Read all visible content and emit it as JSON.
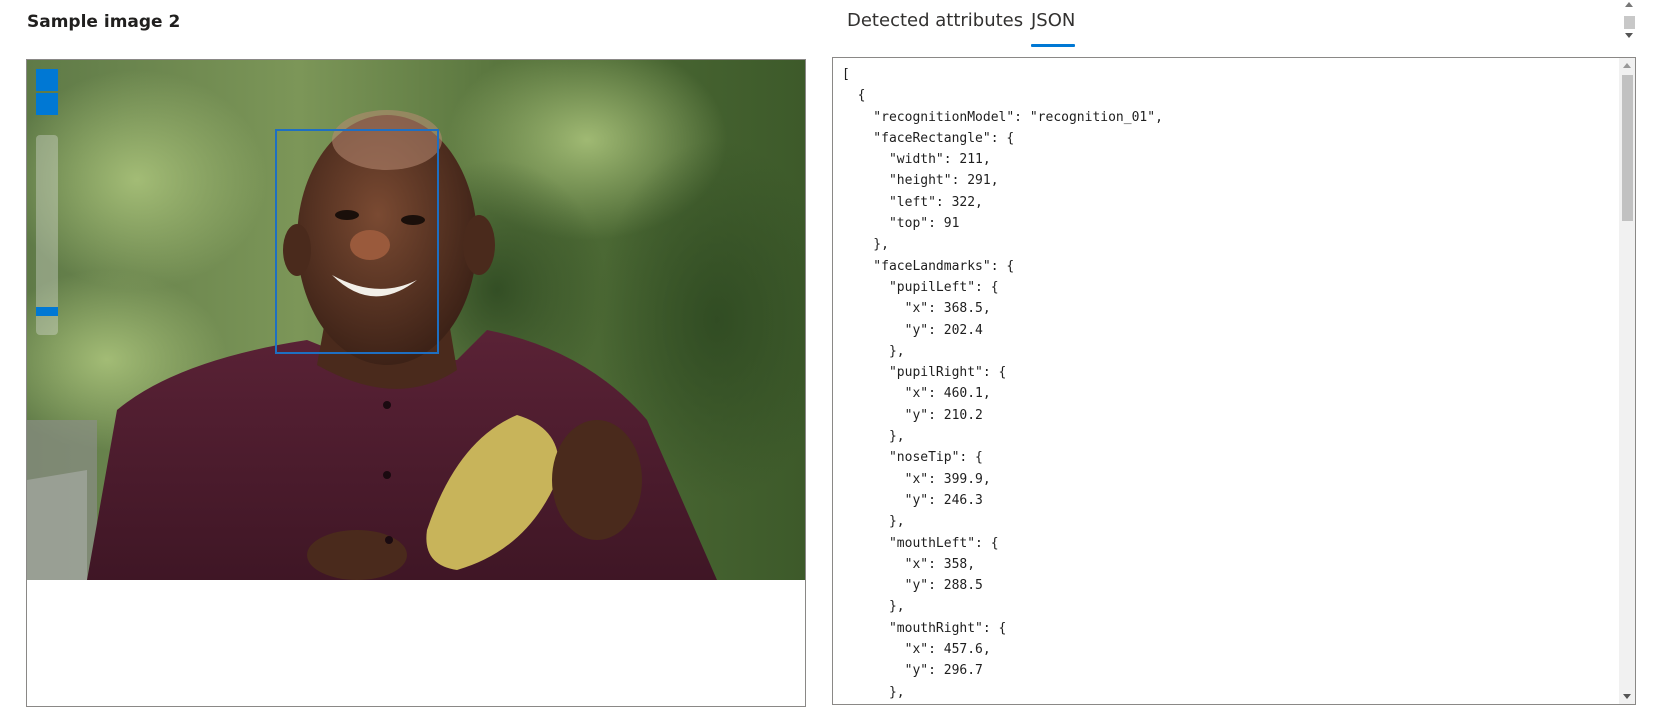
{
  "sample_title": "Sample image 2",
  "tabs": [
    {
      "label": "Detected attributes",
      "selected": false
    },
    {
      "label": "JSON",
      "selected": true
    }
  ],
  "accent_color": "#0078d4",
  "json_lines": [
    "[",
    "  {",
    "    \"recognitionModel\": \"recognition_01\",",
    "    \"faceRectangle\": {",
    "      \"width\": 211,",
    "      \"height\": 291,",
    "      \"left\": 322,",
    "      \"top\": 91",
    "    },",
    "    \"faceLandmarks\": {",
    "      \"pupilLeft\": {",
    "        \"x\": 368.5,",
    "        \"y\": 202.4",
    "      },",
    "      \"pupilRight\": {",
    "        \"x\": 460.1,",
    "        \"y\": 210.2",
    "      },",
    "      \"noseTip\": {",
    "        \"x\": 399.9,",
    "        \"y\": 246.3",
    "      },",
    "      \"mouthLeft\": {",
    "        \"x\": 358,",
    "        \"y\": 288.5",
    "      },",
    "      \"mouthRight\": {",
    "        \"x\": 457.6,",
    "        \"y\": 296.7",
    "      },"
  ]
}
